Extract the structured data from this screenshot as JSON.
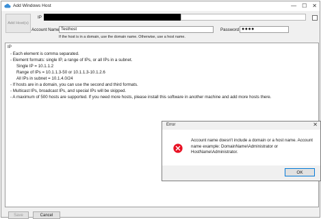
{
  "window": {
    "title": "Add Windows Host",
    "controls": {
      "minimize": "—",
      "maximize": "☐",
      "close": "✕"
    }
  },
  "form": {
    "add_hosts_label": "Add Host(s)",
    "ip_label": "IP",
    "account_label": "Account Name",
    "account_value": "Testhost",
    "password_label": "Password",
    "password_value": "●●●●",
    "hint": "If the host is in a domain, use the domain name. Otherwise, use a host name."
  },
  "help": {
    "heading": "IP",
    "lines": [
      "- Each element is comma separated.",
      "- Element formats: single IP, a range of IPs, or all IPs in a subnet.",
      "Single IP = 10.1.1.2",
      "Range of IPs = 10.1.1.3-50 or 10.1.1.3-10.1.2.6",
      "All IPs in subnet = 10.1.4.0/24",
      "- If hosts are in a domain, you can use the second and third formats.",
      "- Multicast IPs, broadcast IPs, and special IPs will be skipped.",
      "- A maximum of 500 hosts are supported. If you need more hosts, please install this software in another machine and add more hosts there."
    ]
  },
  "buttons": {
    "save": "Save",
    "cancel": "Cancel"
  },
  "error_dialog": {
    "title": "Error",
    "close": "✕",
    "message": "Account name doesn't include a domain or a host name. Account name example: DomainName\\Administrator or HostName\\Administrator.",
    "ok": "OK"
  },
  "colors": {
    "error_icon": "#e81123",
    "accent_border": "#0078d7",
    "ip_redaction": "#000000"
  }
}
